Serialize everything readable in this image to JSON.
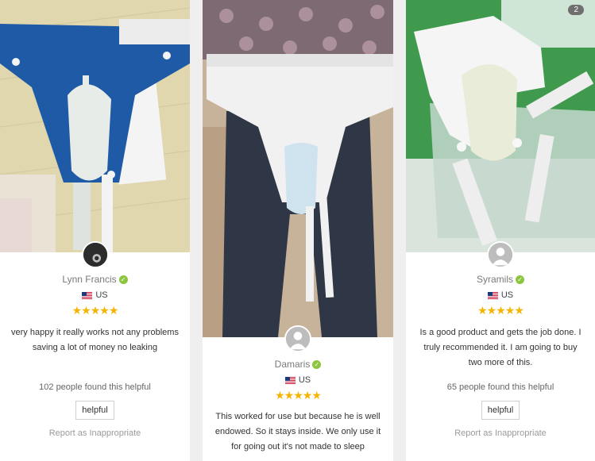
{
  "page_badge": "2",
  "reviews": [
    {
      "name": "Lynn Francis",
      "country": "US",
      "stars": "★★★★★",
      "text": "very happy it really works not any problems saving a lot of money no leaking",
      "helpful_count": "102 people found this helpful",
      "helpful_label": "helpful",
      "report_label": "Report as Inappropriate"
    },
    {
      "name": "Damaris",
      "country": "US",
      "stars": "★★★★★",
      "text": "This worked for use but because he is well endowed. So it stays inside. We only use it for going out it's not made to sleep"
    },
    {
      "name": "Syramils",
      "country": "US",
      "stars": "★★★★★",
      "text": "Is a good product and gets the job done. I truly recommended it. I am going to buy two more of this.",
      "helpful_count": "65 people found this helpful",
      "helpful_label": "helpful",
      "report_label": "Report as Inappropriate"
    }
  ],
  "colors": {
    "star": "#f5b400",
    "verified": "#8cc63f"
  },
  "icons": {
    "verified": "check-circle-icon",
    "flag": "us-flag-icon",
    "avatar_default": "user-silhouette-icon"
  }
}
